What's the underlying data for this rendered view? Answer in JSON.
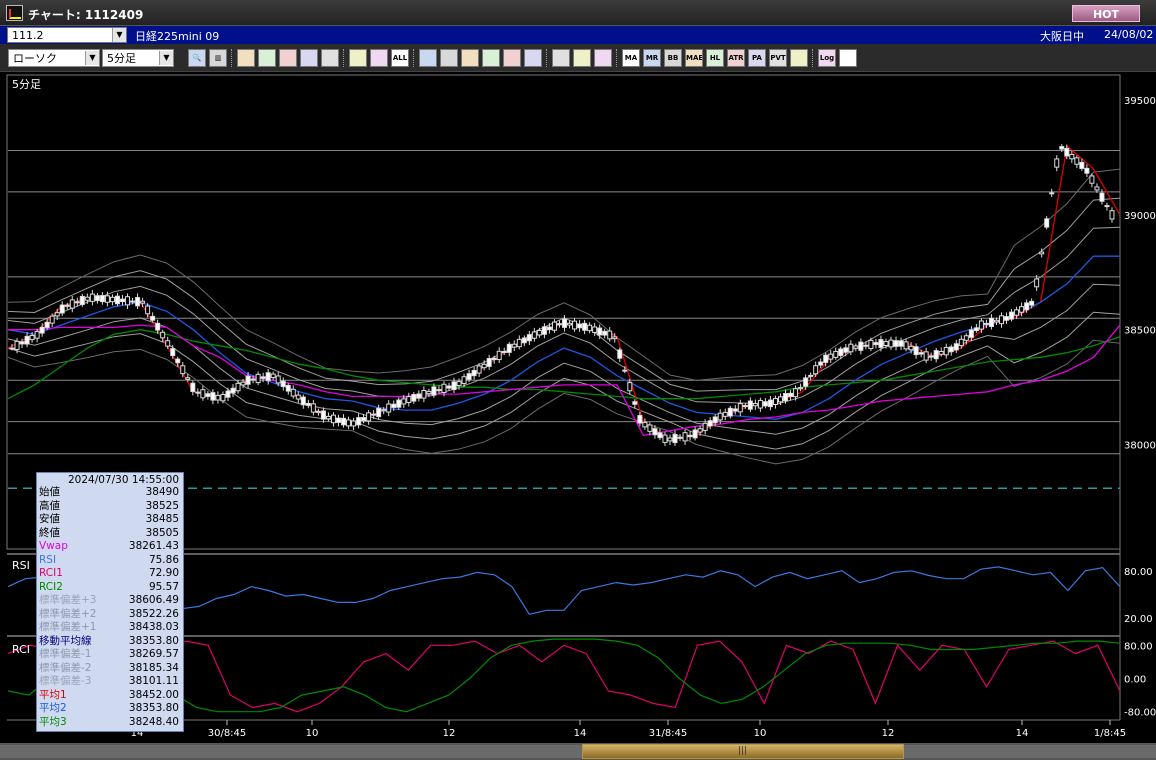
{
  "window": {
    "title": "チャート: 1112409",
    "hot_label": "HOT"
  },
  "symbol_bar": {
    "symbol_value": "111.2",
    "symbol_name": "日経225mini 09",
    "session": "大阪日中",
    "date": "24/08/02"
  },
  "toolbar": {
    "chart_type": "ローソク",
    "timeframe": "5分足",
    "buttons": [
      {
        "name": "zoom-icon",
        "label": "🔍"
      },
      {
        "name": "bar-spacing-icon",
        "label": "▥"
      },
      {
        "name": "draw-icon-1",
        "label": ""
      },
      {
        "name": "draw-icon-2",
        "label": ""
      },
      {
        "name": "draw-icon-3",
        "label": ""
      },
      {
        "name": "draw-icon-4",
        "label": ""
      },
      {
        "name": "draw-icon-5",
        "label": ""
      },
      {
        "name": "candle-icon-1",
        "label": ""
      },
      {
        "name": "candle-icon-2",
        "label": ""
      },
      {
        "name": "all-button",
        "label": "ALL"
      },
      {
        "name": "pen-icon",
        "label": ""
      },
      {
        "name": "line-icon",
        "label": ""
      },
      {
        "name": "cursor-icon",
        "label": ""
      },
      {
        "name": "undo-icon",
        "label": ""
      },
      {
        "name": "note-icon",
        "label": ""
      },
      {
        "name": "trash-icon",
        "label": ""
      },
      {
        "name": "settings-icon",
        "label": ""
      },
      {
        "name": "wrench-icon",
        "label": ""
      },
      {
        "name": "color-icon",
        "label": ""
      },
      {
        "name": "ma-button",
        "label": "MA"
      },
      {
        "name": "mr-button",
        "label": "MR"
      },
      {
        "name": "bb-button",
        "label": "BB"
      },
      {
        "name": "mae-button",
        "label": "MAE"
      },
      {
        "name": "hl-button",
        "label": "HL"
      },
      {
        "name": "atr-button",
        "label": "ATR"
      },
      {
        "name": "pa-button",
        "label": "PA"
      },
      {
        "name": "pvt-button",
        "label": "PVT"
      },
      {
        "name": "frame-icon",
        "label": ""
      },
      {
        "name": "log-button",
        "label": "Log"
      },
      {
        "name": "export-icon",
        "label": ""
      }
    ]
  },
  "chart": {
    "timeframe_label": "5分足",
    "price_axis": [
      "39500",
      "39000",
      "38500",
      "38000"
    ],
    "rsi_label": "RSI",
    "rsi_axis": [
      "80.00",
      "20.00"
    ],
    "rci_label": "RCI",
    "rci_axis": [
      "80.00",
      "0.00",
      "-80.00"
    ],
    "time_axis": [
      "14",
      "30/8:45",
      "10",
      "12",
      "14",
      "31/8:45",
      "10",
      "12",
      "14",
      "1/8:45"
    ]
  },
  "data_panel": {
    "timestamp": "2024/07/30  14:55:00",
    "rows": [
      {
        "label": "始値",
        "value": "38490",
        "color": "#000000"
      },
      {
        "label": "高値",
        "value": "38525",
        "color": "#000000"
      },
      {
        "label": "安値",
        "value": "38485",
        "color": "#000000"
      },
      {
        "label": "終値",
        "value": "38505",
        "color": "#000000"
      },
      {
        "label": "Vwap",
        "value": "38261.43",
        "color": "#e000e0"
      },
      {
        "label": "RSI",
        "value": "75.86",
        "color": "#3a78e0"
      },
      {
        "label": "RCI1",
        "value": "72.90",
        "color": "#e0006a"
      },
      {
        "label": "RCI2",
        "value": "95.57",
        "color": "#008a00"
      },
      {
        "label": "標準偏差+3",
        "value": "38606.49",
        "color": "#9aa4b8"
      },
      {
        "label": "標準偏差+2",
        "value": "38522.26",
        "color": "#8f99ad"
      },
      {
        "label": "標準偏差+1",
        "value": "38438.03",
        "color": "#8f99ad"
      },
      {
        "label": "移動平均線",
        "value": "38353.80",
        "color": "#000080"
      },
      {
        "label": "標準偏差-1",
        "value": "38269.57",
        "color": "#8f99ad"
      },
      {
        "label": "標準偏差-2",
        "value": "38185.34",
        "color": "#8f99ad"
      },
      {
        "label": "標準偏差-3",
        "value": "38101.11",
        "color": "#9aa4b8"
      },
      {
        "label": "平均1",
        "value": "38452.00",
        "color": "#e00000"
      },
      {
        "label": "平均2",
        "value": "38353.80",
        "color": "#1a5ae0"
      },
      {
        "label": "平均3",
        "value": "38248.40",
        "color": "#008a00"
      }
    ]
  },
  "chart_data": {
    "type": "line",
    "price_ticks": [
      39500,
      39000,
      38500,
      38000
    ],
    "ylim": [
      37550,
      39600
    ],
    "rsi_ticks": [
      80,
      20
    ],
    "rci_ticks": [
      80,
      0,
      -80
    ],
    "x_tick_labels": [
      "14",
      "30/8:45",
      "10",
      "12",
      "14",
      "31/8:45",
      "10",
      "12",
      "14",
      "1/8:45"
    ],
    "hlines": [
      39280,
      39100,
      38730,
      38550,
      38280,
      38100,
      37960
    ],
    "dashed_line": 37810,
    "series": [
      {
        "name": "平均1",
        "color": "#e00000",
        "values": [
          38420,
          38480,
          38600,
          38640,
          38630,
          38620,
          38430,
          38230,
          38200,
          38280,
          38300,
          38200,
          38120,
          38090,
          38140,
          38190,
          38230,
          38260,
          38340,
          38420,
          38480,
          38530,
          38510,
          38470,
          38100,
          38020,
          38040,
          38120,
          38170,
          38180,
          38230,
          38370,
          38420,
          38440,
          38440,
          38380,
          38420,
          38520,
          38550,
          38620,
          39300,
          39200,
          39000
        ]
      },
      {
        "name": "平均2",
        "color": "#1a5ae0",
        "values": [
          38500,
          38480,
          38520,
          38560,
          38600,
          38620,
          38580,
          38500,
          38400,
          38310,
          38270,
          38230,
          38200,
          38190,
          38160,
          38150,
          38150,
          38180,
          38220,
          38280,
          38360,
          38420,
          38380,
          38300,
          38240,
          38180,
          38140,
          38130,
          38120,
          38110,
          38140,
          38200,
          38280,
          38350,
          38400,
          38450,
          38490,
          38520,
          38560,
          38620,
          38700,
          38820,
          38820
        ]
      },
      {
        "name": "平均3",
        "color": "#008a00",
        "values": [
          38200,
          38260,
          38340,
          38420,
          38480,
          38500,
          38480,
          38450,
          38430,
          38410,
          38380,
          38350,
          38330,
          38300,
          38280,
          38270,
          38260,
          38250,
          38250,
          38240,
          38240,
          38230,
          38220,
          38210,
          38200,
          38200,
          38200,
          38210,
          38220,
          38230,
          38250,
          38260,
          38270,
          38280,
          38300,
          38320,
          38340,
          38360,
          38370,
          38380,
          38400,
          38430,
          38470
        ]
      },
      {
        "name": "Vwap",
        "color": "#e000e0",
        "values": [
          38500,
          38500,
          38510,
          38510,
          38510,
          38520,
          38510,
          38430,
          38380,
          38300,
          38280,
          38260,
          38230,
          38210,
          38210,
          38210,
          38220,
          38220,
          38230,
          38240,
          38250,
          38260,
          38260,
          38260,
          38040,
          38060,
          38080,
          38090,
          38110,
          38120,
          38140,
          38150,
          38170,
          38190,
          38200,
          38210,
          38220,
          38230,
          38260,
          38280,
          38320,
          38380,
          38520
        ]
      },
      {
        "name": "RSI",
        "color": "#3a78e0",
        "values": [
          60,
          70,
          72,
          65,
          58,
          40,
          30,
          35,
          30,
          28,
          32,
          35,
          45,
          50,
          60,
          55,
          48,
          50,
          45,
          40,
          40,
          45,
          55,
          60,
          65,
          70,
          72,
          78,
          75,
          60,
          25,
          30,
          30,
          55,
          60,
          65,
          62,
          65,
          70,
          75,
          72,
          80,
          75,
          60,
          72,
          78,
          70,
          75,
          80,
          65,
          70,
          78,
          80,
          74,
          70,
          70,
          82,
          85,
          80,
          75,
          78,
          55,
          80,
          84,
          60
        ]
      },
      {
        "name": "RCI1",
        "color": "#e0006a",
        "values": [
          60,
          80,
          70,
          90,
          20,
          -60,
          -40,
          70,
          90,
          80,
          -40,
          -70,
          -60,
          -80,
          -60,
          -20,
          40,
          60,
          20,
          80,
          80,
          90,
          60,
          80,
          40,
          80,
          60,
          -30,
          -40,
          -60,
          -70,
          80,
          90,
          40,
          -60,
          80,
          60,
          90,
          70,
          -60,
          80,
          20,
          80,
          70,
          -20,
          70,
          80,
          90,
          60,
          80,
          -30
        ]
      },
      {
        "name": "RCI2",
        "color": "#008a00",
        "values": [
          -30,
          -40,
          0,
          40,
          60,
          60,
          50,
          10,
          -40,
          -70,
          -80,
          -80,
          -80,
          -70,
          -40,
          -30,
          -20,
          -40,
          -70,
          -80,
          -60,
          -40,
          0,
          50,
          80,
          90,
          95,
          95,
          95,
          90,
          80,
          50,
          0,
          -40,
          -60,
          -50,
          -20,
          20,
          60,
          80,
          85,
          85,
          85,
          80,
          70,
          70,
          70,
          75,
          80,
          85,
          85,
          90,
          90,
          85
        ]
      }
    ]
  }
}
